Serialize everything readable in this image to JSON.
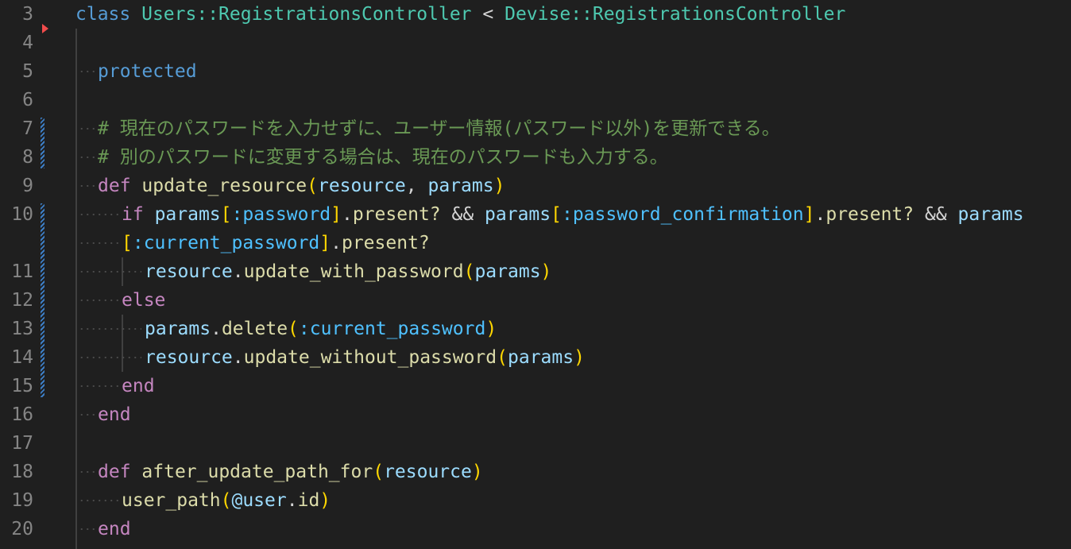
{
  "editor": {
    "lines": [
      {
        "num": "3",
        "tokens": [
          [
            "kwb",
            "class"
          ],
          [
            "plain",
            " "
          ],
          [
            "cls",
            "Users::RegistrationsController"
          ],
          [
            "plain",
            " "
          ],
          [
            "op",
            "<"
          ],
          [
            "plain",
            " "
          ],
          [
            "cls",
            "Devise::RegistrationsController"
          ]
        ]
      },
      {
        "num": "4",
        "tokens": []
      },
      {
        "num": "5",
        "tokens": [
          [
            "kwb",
            "protected"
          ]
        ]
      },
      {
        "num": "6",
        "tokens": []
      },
      {
        "num": "7",
        "tokens": [
          [
            "cm",
            "# 現在のパスワードを入力せずに、ユーザー情報(パスワード以外)を更新できる。"
          ]
        ]
      },
      {
        "num": "8",
        "tokens": [
          [
            "cm",
            "# 別のパスワードに変更する場合は、現在のパスワードも入力する。"
          ]
        ]
      },
      {
        "num": "9",
        "tokens": [
          [
            "kw",
            "def"
          ],
          [
            "plain",
            " "
          ],
          [
            "fn",
            "update_resource"
          ],
          [
            "br",
            "("
          ],
          [
            "var",
            "resource"
          ],
          [
            "plain",
            ", "
          ],
          [
            "var",
            "params"
          ],
          [
            "br",
            ")"
          ]
        ]
      },
      {
        "num": "10",
        "tokens": [
          [
            "kw",
            "if"
          ],
          [
            "plain",
            " "
          ],
          [
            "var",
            "params"
          ],
          [
            "br",
            "["
          ],
          [
            "sym",
            ":password"
          ],
          [
            "br",
            "]"
          ],
          [
            "plain",
            "."
          ],
          [
            "fn",
            "present?"
          ],
          [
            "plain",
            " && "
          ],
          [
            "var",
            "params"
          ],
          [
            "br",
            "["
          ],
          [
            "sym",
            ":password_confirmation"
          ],
          [
            "br",
            "]"
          ],
          [
            "plain",
            "."
          ],
          [
            "fn",
            "present?"
          ],
          [
            "plain",
            " && "
          ],
          [
            "var",
            "params"
          ]
        ]
      },
      {
        "num": "",
        "tokens": [
          [
            "br",
            "["
          ],
          [
            "sym",
            ":current_password"
          ],
          [
            "br",
            "]"
          ],
          [
            "plain",
            "."
          ],
          [
            "fn",
            "present?"
          ]
        ]
      },
      {
        "num": "11",
        "tokens": [
          [
            "var",
            "resource"
          ],
          [
            "plain",
            "."
          ],
          [
            "fn",
            "update_with_password"
          ],
          [
            "br",
            "("
          ],
          [
            "var",
            "params"
          ],
          [
            "br",
            ")"
          ]
        ]
      },
      {
        "num": "12",
        "tokens": [
          [
            "kw",
            "else"
          ]
        ]
      },
      {
        "num": "13",
        "tokens": [
          [
            "var",
            "params"
          ],
          [
            "plain",
            "."
          ],
          [
            "fn",
            "delete"
          ],
          [
            "br",
            "("
          ],
          [
            "sym",
            ":current_password"
          ],
          [
            "br",
            ")"
          ]
        ]
      },
      {
        "num": "14",
        "tokens": [
          [
            "var",
            "resource"
          ],
          [
            "plain",
            "."
          ],
          [
            "fn",
            "update_without_password"
          ],
          [
            "br",
            "("
          ],
          [
            "var",
            "params"
          ],
          [
            "br",
            ")"
          ]
        ]
      },
      {
        "num": "15",
        "tokens": [
          [
            "kw",
            "end"
          ]
        ]
      },
      {
        "num": "16",
        "tokens": [
          [
            "kw",
            "end"
          ]
        ]
      },
      {
        "num": "17",
        "tokens": []
      },
      {
        "num": "18",
        "tokens": [
          [
            "kw",
            "def"
          ],
          [
            "plain",
            " "
          ],
          [
            "fn",
            "after_update_path_for"
          ],
          [
            "br",
            "("
          ],
          [
            "var",
            "resource"
          ],
          [
            "br",
            ")"
          ]
        ]
      },
      {
        "num": "19",
        "tokens": [
          [
            "fn",
            "user_path"
          ],
          [
            "br",
            "("
          ],
          [
            "ivar",
            "@user"
          ],
          [
            "plain",
            "."
          ],
          [
            "fn",
            "id"
          ],
          [
            "br",
            ")"
          ]
        ]
      },
      {
        "num": "20",
        "tokens": [
          [
            "kw",
            "end"
          ]
        ]
      }
    ]
  },
  "colors": {
    "background": "#1f1f1f",
    "line_number": "#858585",
    "keyword": "#c586c0",
    "keyword_blue": "#569cd6",
    "class_name": "#4ec9b0",
    "function": "#dcdcaa",
    "variable": "#9cdcfe",
    "symbol": "#4fc1ff",
    "bracket": "#ffd700",
    "comment": "#6a9955",
    "modified_gutter": "#3c7ec6",
    "breakpoint": "#f14c4c"
  }
}
